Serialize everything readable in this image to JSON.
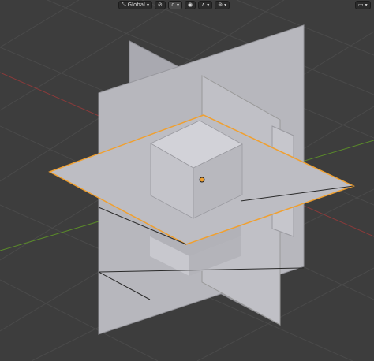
{
  "header": {
    "transform_orientation": "Global",
    "transform_pivot_icon": "pivot-icon",
    "snap_icon": "magnet-icon",
    "snap_target_icon": "snap-increment-icon",
    "proportional_edit_icon": "proportional-edit-icon",
    "falloff_icon": "falloff-curve-icon",
    "overlay_icon": "gizmo-icon",
    "right_icon": "viewport-shading-icon"
  },
  "colors": {
    "background": "#3d3d3d",
    "grid": "#464646",
    "axis_x": "#8a3a3a",
    "axis_y": "#5a8a2a",
    "mesh_face": "#b8b8be",
    "mesh_face_dark": "#a4a4aa",
    "selection": "#f0a030",
    "edge": "#222222"
  }
}
